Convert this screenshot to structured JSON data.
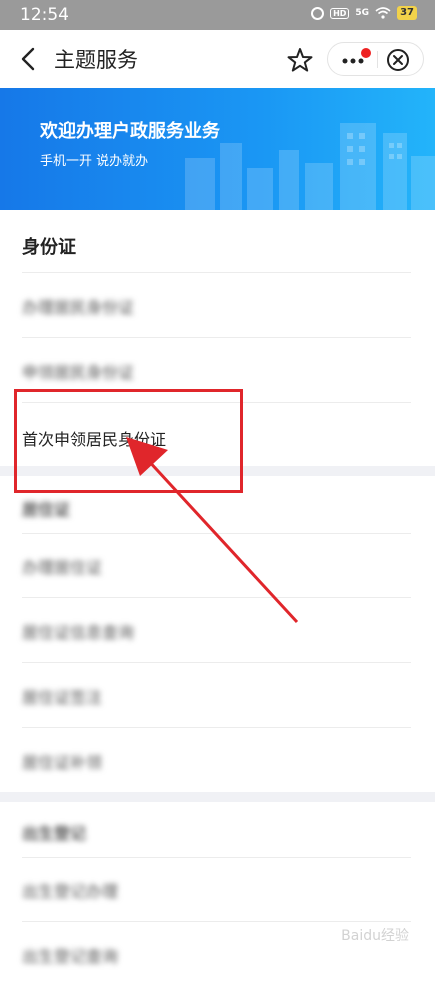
{
  "status_bar": {
    "time": "12:54",
    "network": "5G",
    "battery": "37"
  },
  "nav": {
    "title": "主题服务"
  },
  "banner": {
    "title": "欢迎办理户政服务业务",
    "subtitle": "手机一开 说办就办"
  },
  "section": {
    "title": "身份证",
    "items": [
      {
        "label": "办理居民身份证"
      },
      {
        "label": "申领居民身份证"
      },
      {
        "label": "首次申领居民身份证"
      }
    ]
  },
  "section2": {
    "title": "居住证",
    "items": [
      {
        "label": "办理居住证"
      },
      {
        "label": "居住证信息查询"
      },
      {
        "label": "居住证签注"
      },
      {
        "label": "居住证补领"
      }
    ]
  },
  "section3": {
    "title": "出生登记",
    "items": [
      {
        "label": "出生登记办理"
      },
      {
        "label": "出生登记查询"
      }
    ]
  },
  "watermark": "Baidu经验",
  "colors": {
    "accent": "#1a90f0",
    "highlight": "#e0262b",
    "notify_dot": "#ee2222"
  }
}
